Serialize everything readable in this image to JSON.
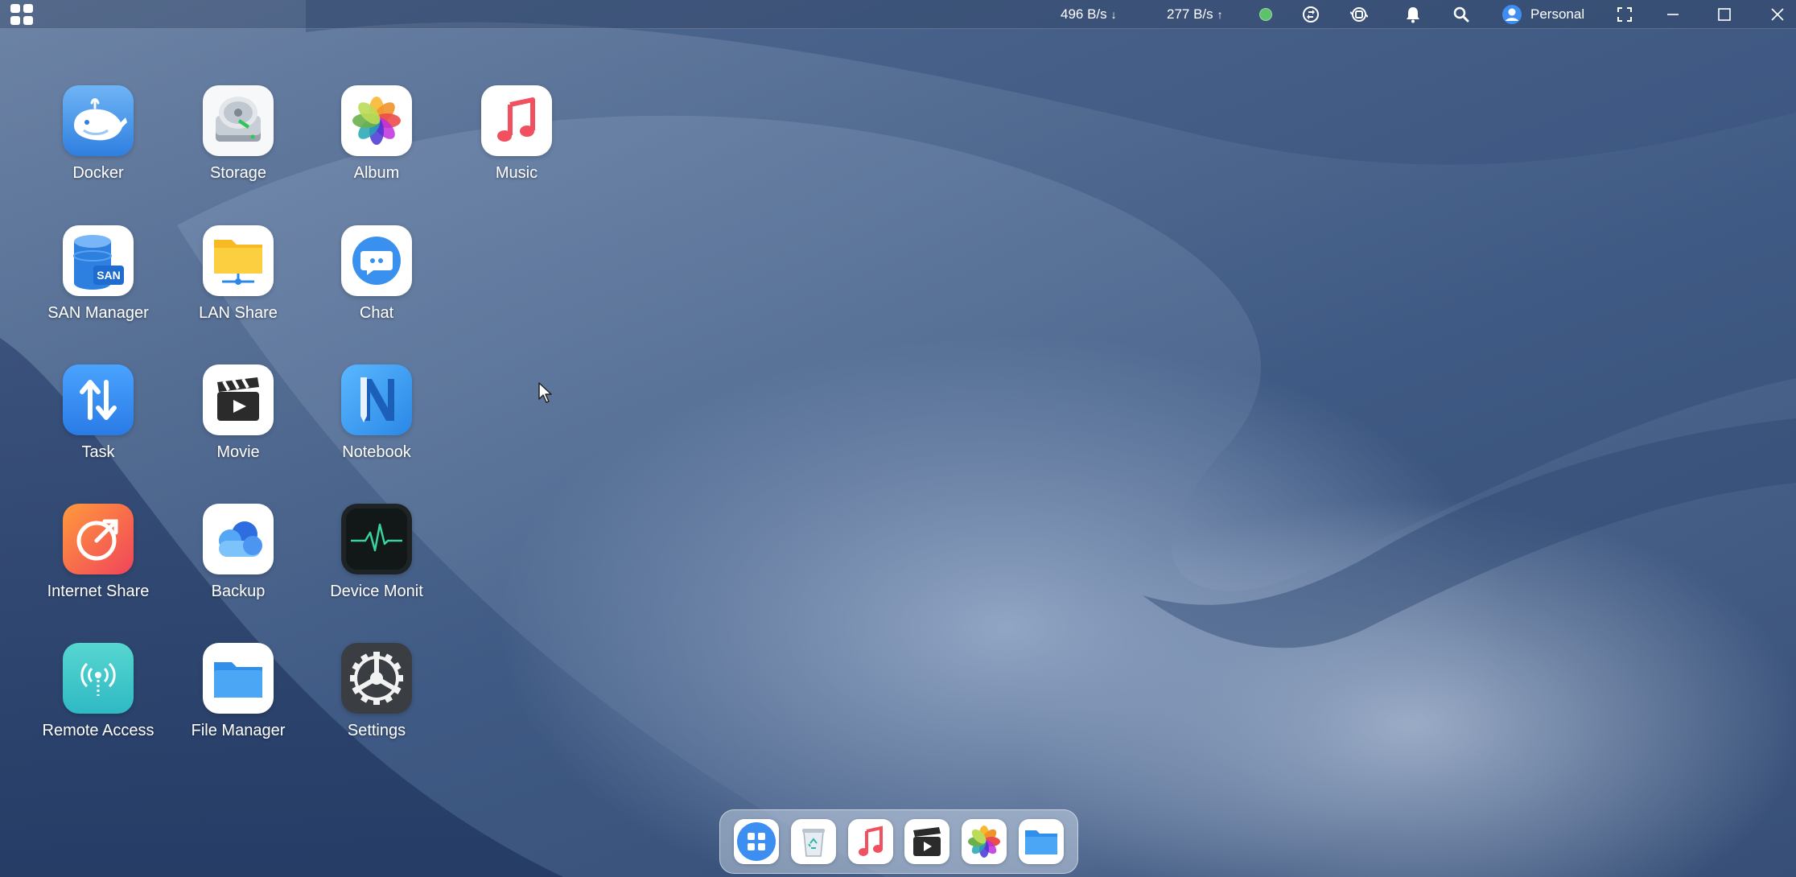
{
  "topbar": {
    "download_speed": "496 B/s",
    "download_arrow": "↓",
    "upload_speed": "277 B/s",
    "upload_arrow": "↑",
    "status_color": "#5cc26b",
    "icons": [
      "grid-icon",
      "sync-icon",
      "backup-icon",
      "bell-icon",
      "search-icon",
      "user-icon",
      "fullscreen-icon",
      "minimize-icon",
      "maximize-icon",
      "close-icon"
    ],
    "user_label": "Personal"
  },
  "apps": [
    {
      "label": "Docker",
      "icon": "docker-whale-icon"
    },
    {
      "label": "Storage",
      "icon": "storage-disk-icon"
    },
    {
      "label": "Album",
      "icon": "album-flower-icon"
    },
    {
      "label": "Music",
      "icon": "music-note-icon"
    },
    {
      "label": "SAN Manager",
      "icon": "san-database-icon",
      "badge": "SAN"
    },
    {
      "label": "LAN Share",
      "icon": "lan-share-folder-icon"
    },
    {
      "label": "Chat",
      "icon": "chat-bubble-icon"
    },
    {
      "label": "Task",
      "icon": "task-arrows-icon"
    },
    {
      "label": "Movie",
      "icon": "movie-clapper-icon"
    },
    {
      "label": "Notebook",
      "icon": "notebook-n-icon"
    },
    {
      "label": "Internet Share",
      "icon": "internet-share-icon"
    },
    {
      "label": "Backup",
      "icon": "backup-cloud-icon"
    },
    {
      "label": "Device Monit",
      "icon": "device-monitor-pulse-icon"
    },
    {
      "label": "Remote Access",
      "icon": "remote-access-antenna-icon"
    },
    {
      "label": "File Manager",
      "icon": "file-folder-icon"
    },
    {
      "label": "Settings",
      "icon": "settings-gear-icon"
    }
  ],
  "dock": [
    "launcher-grid-icon",
    "recycle-bin-icon",
    "music-note-icon",
    "movie-clapper-icon",
    "album-flower-icon",
    "file-folder-icon"
  ]
}
